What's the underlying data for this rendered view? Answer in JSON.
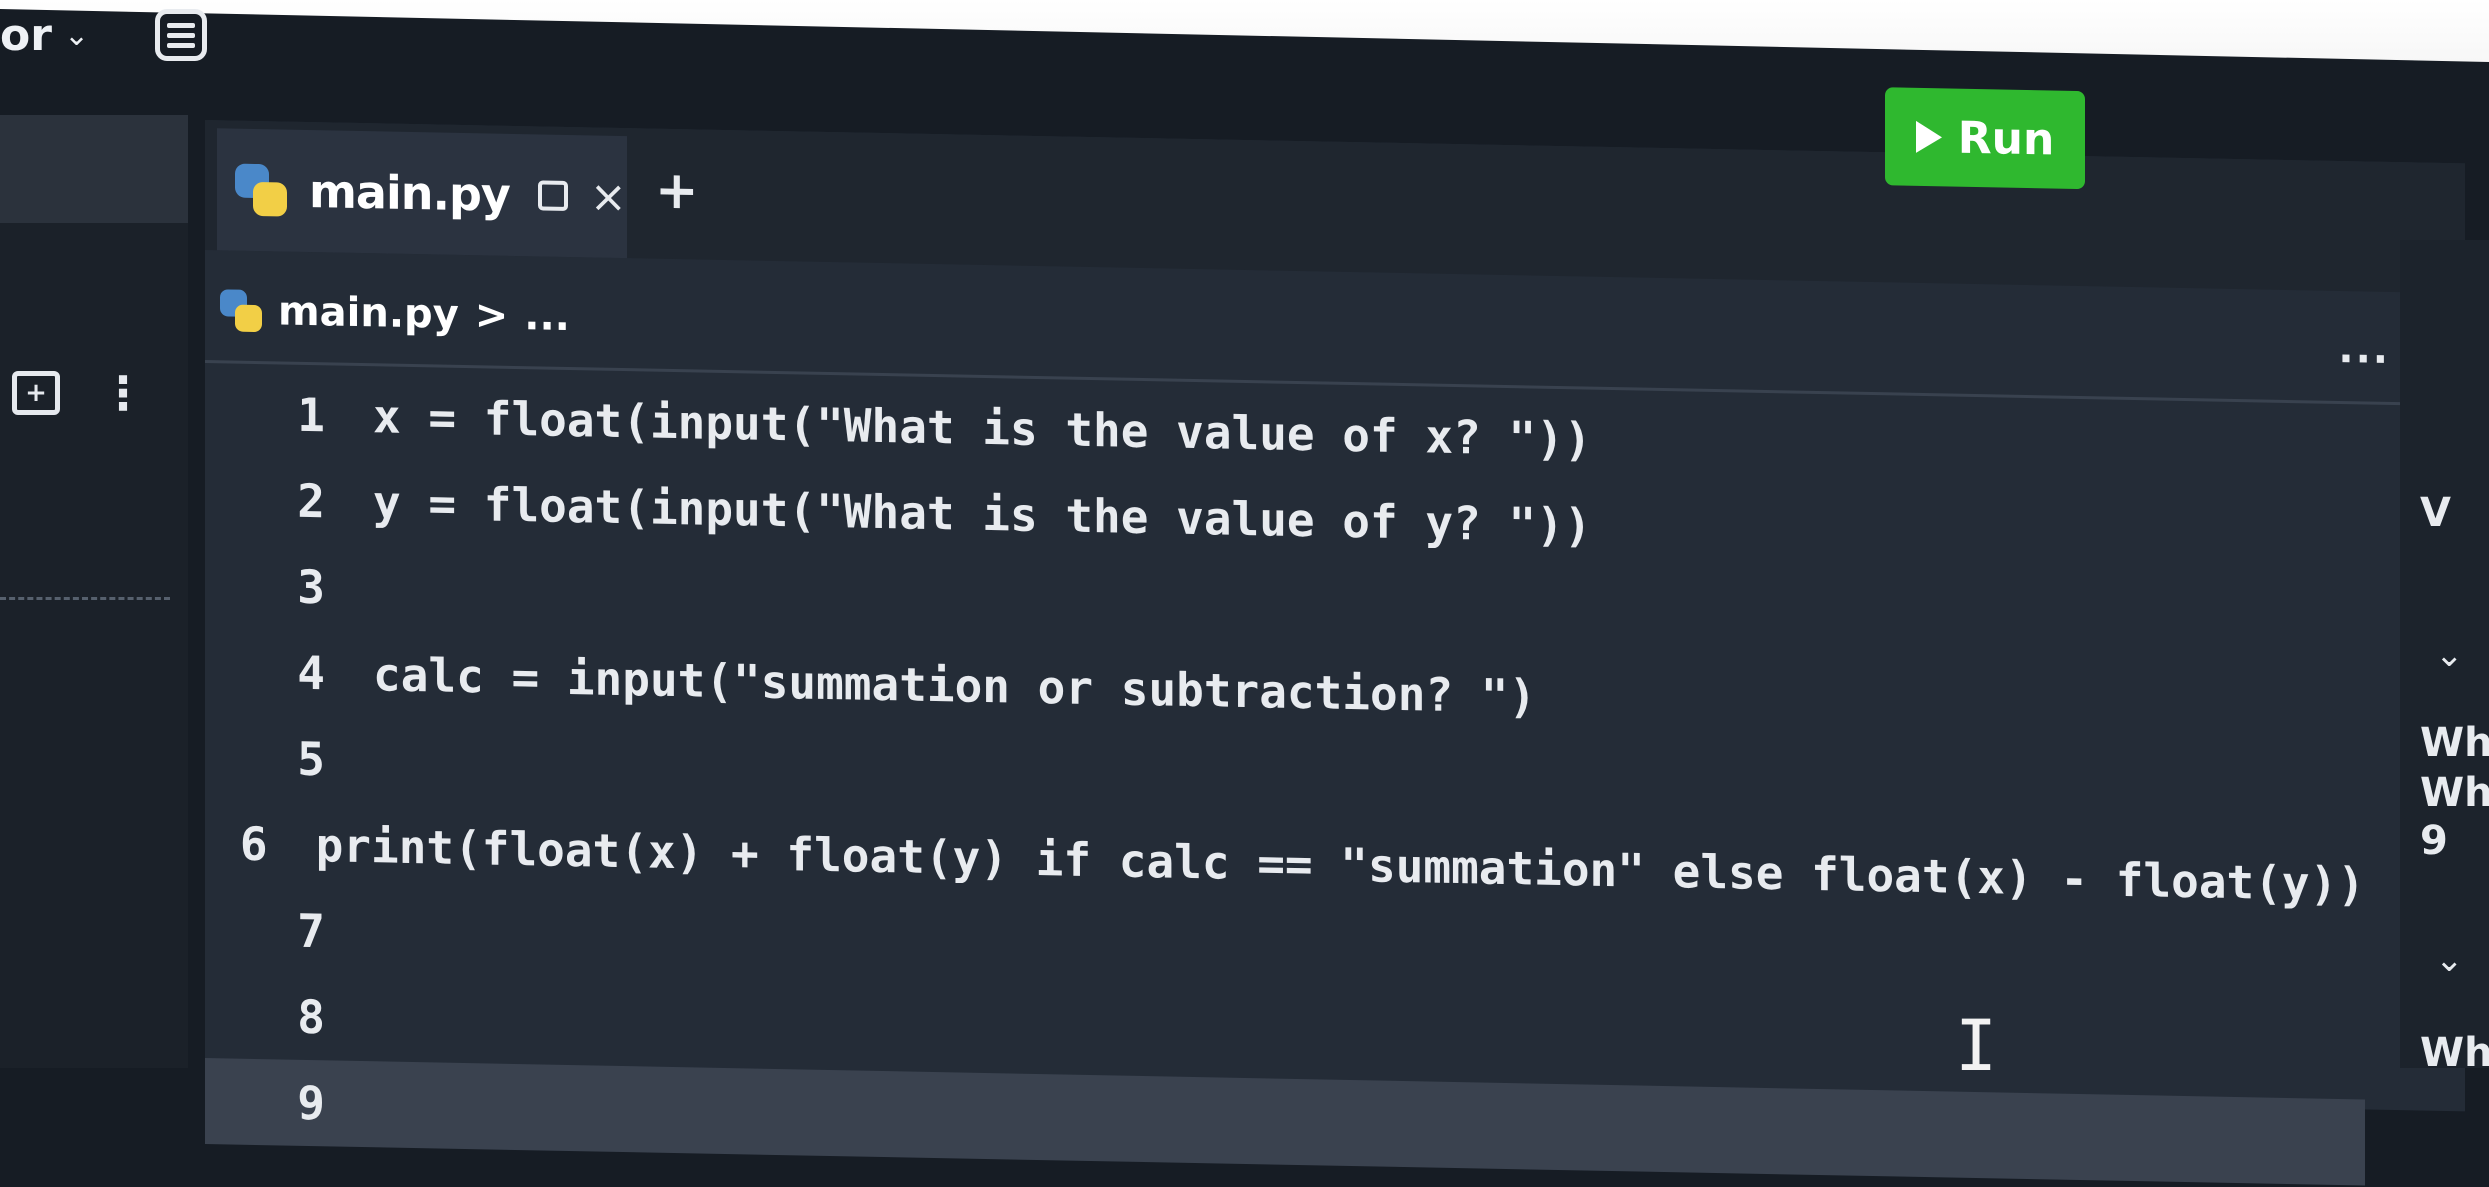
{
  "topbar": {
    "label": "or",
    "chevron": "⌄",
    "db_icon": "database-icon"
  },
  "sidebar": {
    "folder_icon": "add-folder-icon",
    "menu_icon": "kebab-menu-icon"
  },
  "tabs": [
    {
      "label": "main.py",
      "icon": "python-icon",
      "close": "×"
    }
  ],
  "tab_add": "+",
  "run_button": {
    "label": "Run",
    "color": "#2fb82f"
  },
  "breadcrumb": {
    "file": "main.py",
    "separator": ">",
    "more": "..."
  },
  "editor_more": "...",
  "code": {
    "lines": [
      {
        "n": "1",
        "text": "x = float(input(\"What is the value of x? \"))"
      },
      {
        "n": "2",
        "text": "y = float(input(\"What is the value of y? \"))"
      },
      {
        "n": "3",
        "text": ""
      },
      {
        "n": "4",
        "text": "calc = input(\"summation or subtraction? \")"
      },
      {
        "n": "5",
        "text": ""
      },
      {
        "n": "6",
        "text": "print(float(x) + float(y) if calc == \"summation\" else float(x) - float(y))"
      },
      {
        "n": "7",
        "text": ""
      },
      {
        "n": "8",
        "text": ""
      },
      {
        "n": "9",
        "text": ""
      }
    ],
    "current_line": "9"
  },
  "console": {
    "l1": "V",
    "l2": "Wh",
    "l3": "Wha",
    "l4": "9",
    "l5": "What"
  }
}
